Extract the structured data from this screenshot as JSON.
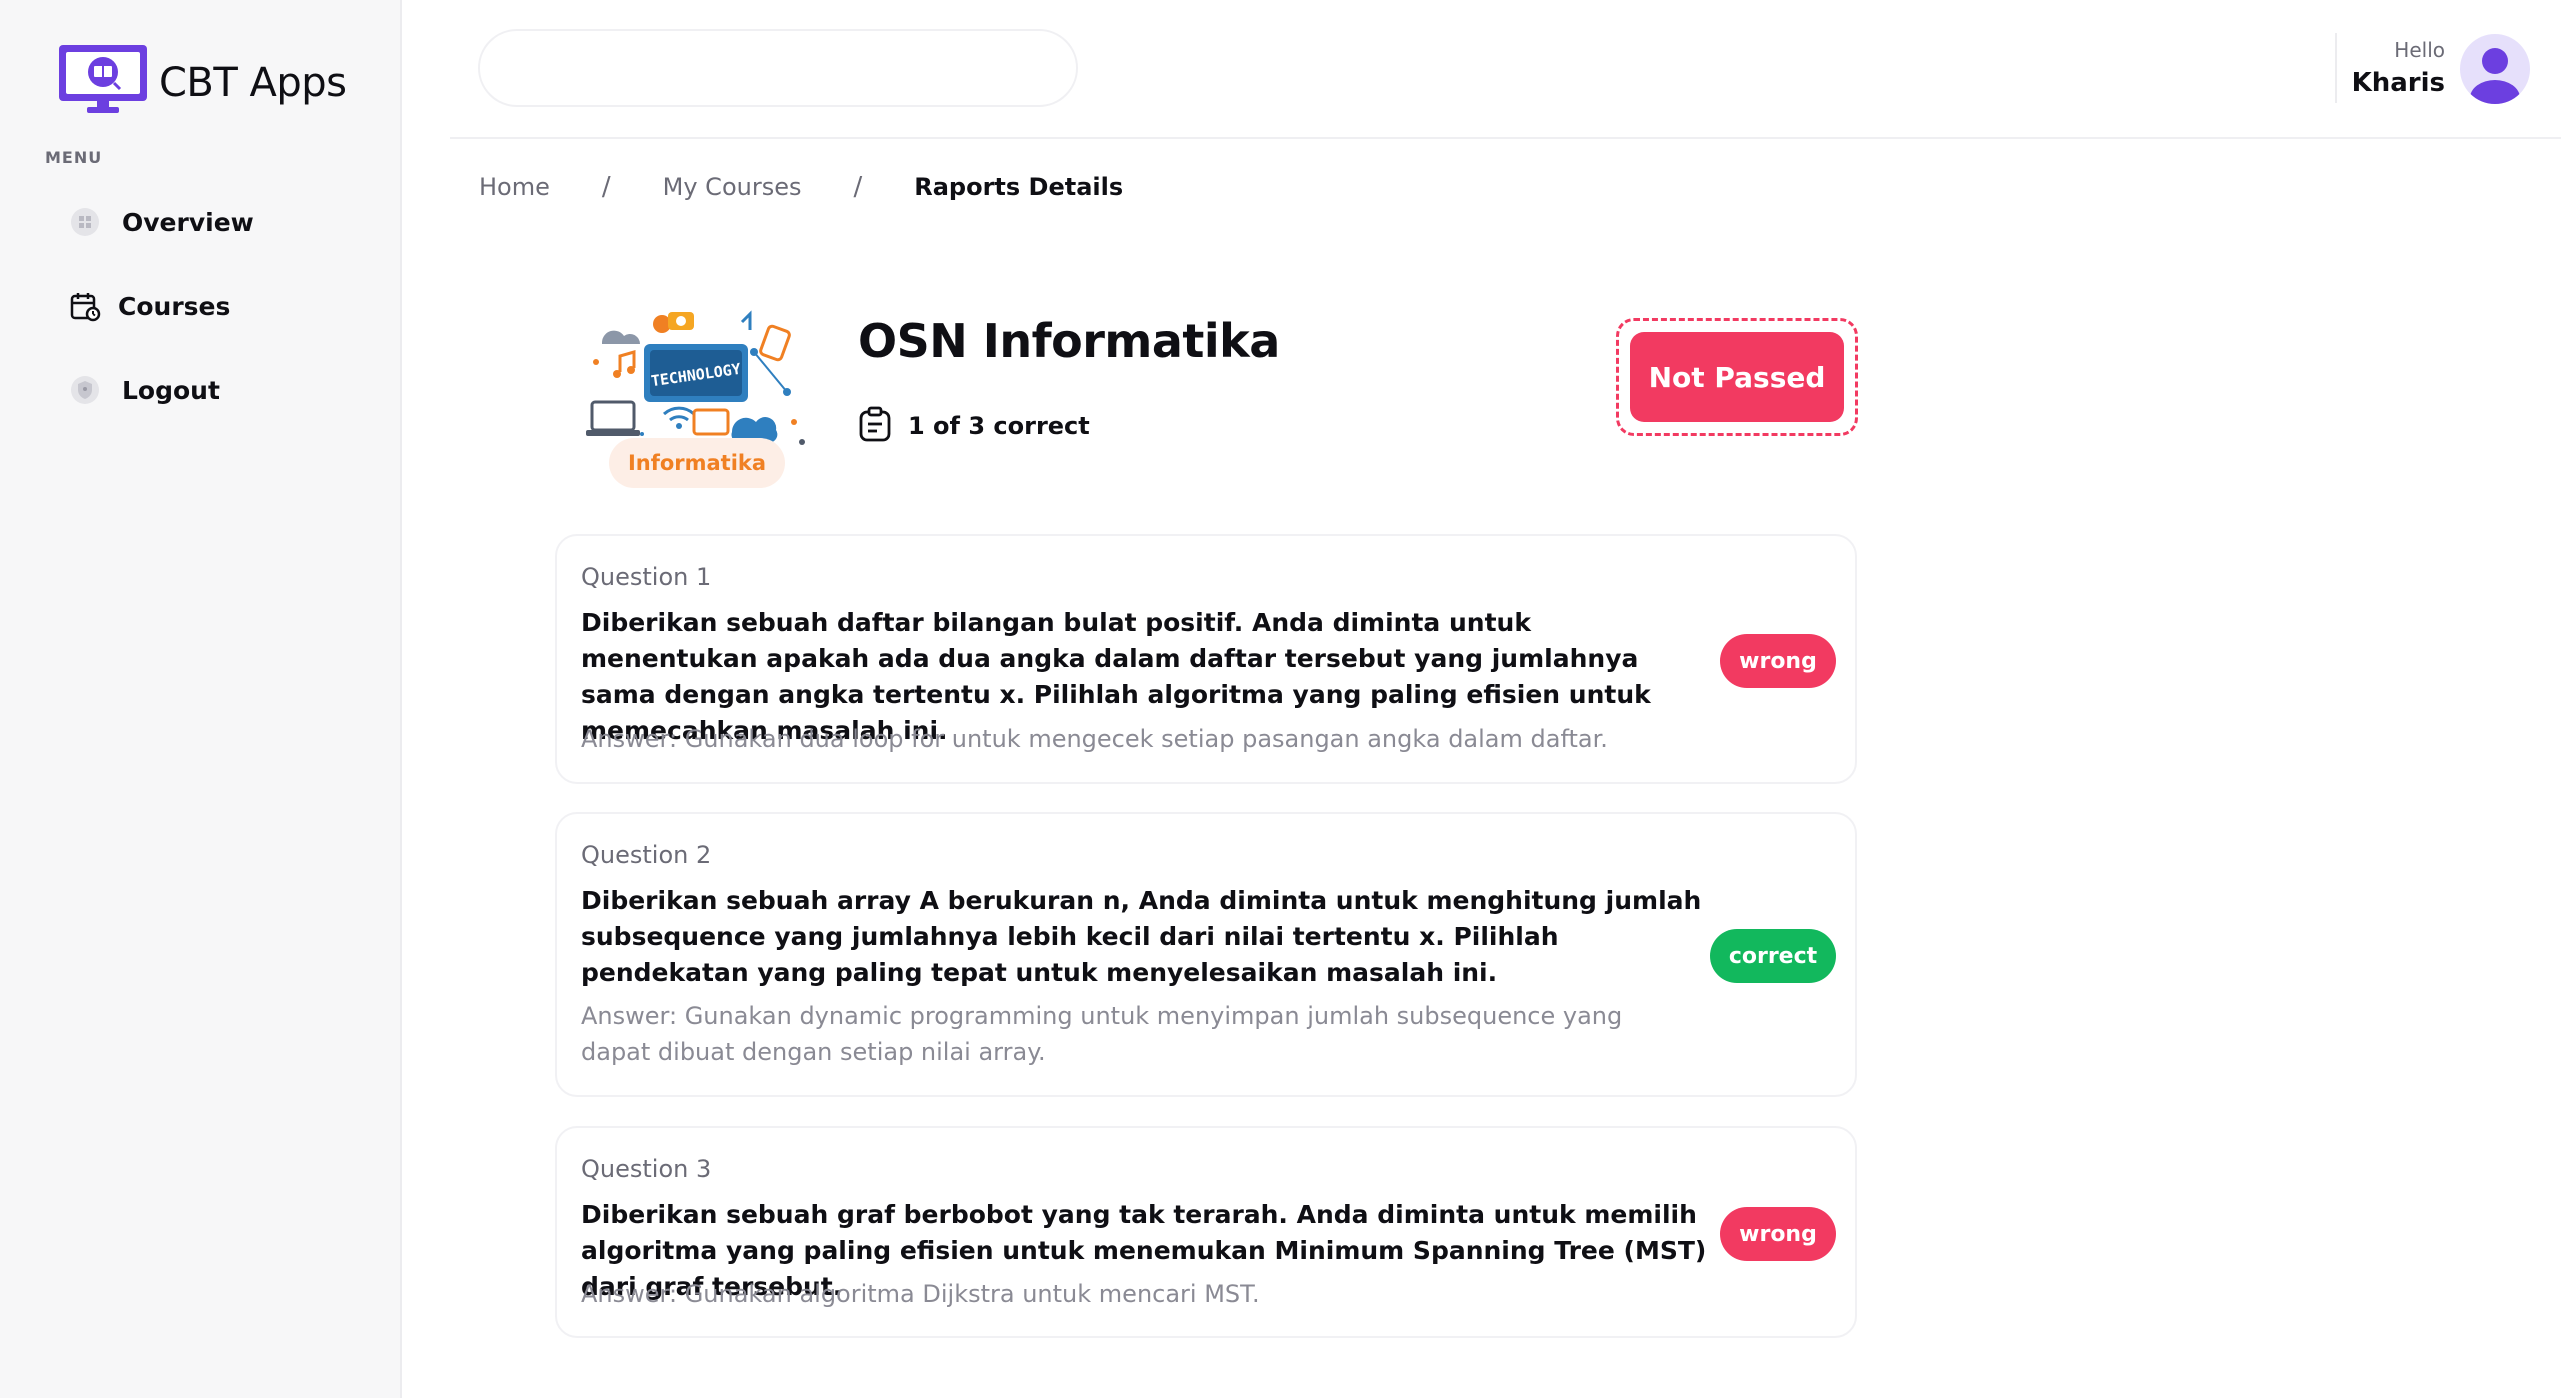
{
  "app": {
    "name": "CBT Apps"
  },
  "sidebar": {
    "menu_label": "MENU",
    "items": [
      {
        "label": "Overview",
        "icon": "grid-icon"
      },
      {
        "label": "Courses",
        "icon": "calendar-icon"
      },
      {
        "label": "Logout",
        "icon": "shield-icon"
      }
    ]
  },
  "header": {
    "search_value": "",
    "greeting": "Hello",
    "username": "Kharis"
  },
  "breadcrumb": {
    "items": [
      "Home",
      "My Courses",
      "Raports Details"
    ],
    "separator": "/"
  },
  "course": {
    "title": "OSN Informatika",
    "tag": "Informatika",
    "thumbnail_text": "TECHNOLOGY",
    "score_text": "1 of 3 correct",
    "status": "Not Passed"
  },
  "questions": [
    {
      "number": "Question 1",
      "text": "Diberikan sebuah daftar bilangan bulat positif. Anda diminta untuk menentukan apakah ada dua angka dalam daftar tersebut yang jumlahnya sama dengan angka tertentu x. Pilihlah algoritma yang paling efisien untuk memecahkan masalah ini.",
      "answer": "Answer: Gunakan dua loop for untuk mengecek setiap pasangan angka dalam daftar.",
      "result": "wrong"
    },
    {
      "number": "Question 2",
      "text": "Diberikan sebuah array A berukuran n, Anda diminta untuk menghitung jumlah subsequence yang jumlahnya lebih kecil dari nilai tertentu x. Pilihlah pendekatan yang paling tepat untuk menyelesaikan masalah ini.",
      "answer": "Answer: Gunakan dynamic programming untuk menyimpan jumlah subsequence yang dapat dibuat dengan setiap nilai array.",
      "result": "correct"
    },
    {
      "number": "Question 3",
      "text": "Diberikan sebuah graf berbobot yang tak terarah. Anda diminta untuk memilih algoritma yang paling efisien untuk menemukan Minimum Spanning Tree (MST) dari graf tersebut.",
      "answer": "Answer: Gunakan algoritma Dijkstra untuk mencari MST.",
      "result": "wrong"
    }
  ],
  "colors": {
    "accent": "#6c3fe0",
    "danger": "#f23a61",
    "success": "#12b85d",
    "tag_text": "#f08023"
  }
}
